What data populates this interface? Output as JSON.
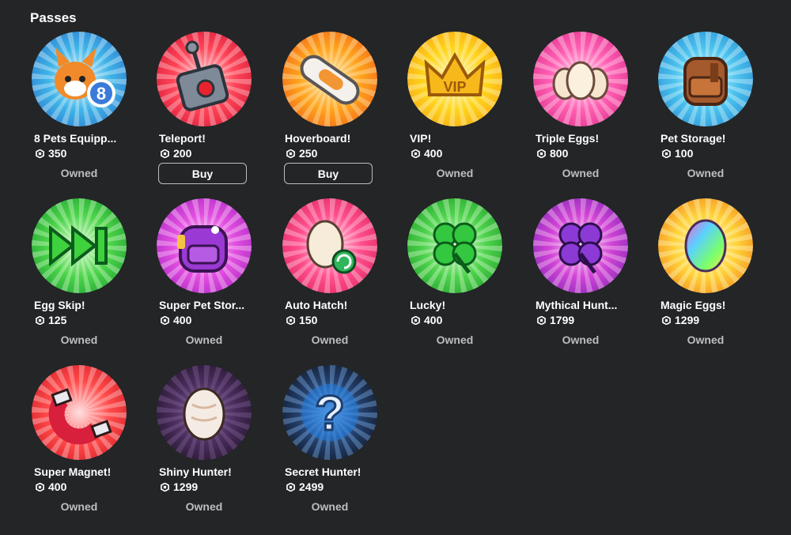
{
  "section_title": "Passes",
  "buy_label": "Buy",
  "owned_label": "Owned",
  "passes": [
    {
      "name": "8 Pets Equipp...",
      "price": "350",
      "status": "Owned",
      "icon": "dog-pet-icon",
      "colors": [
        "#e9fbff",
        "#3fb3e8",
        "#2f7fd0"
      ]
    },
    {
      "name": "Teleport!",
      "price": "200",
      "status": "Buy",
      "icon": "teleport-button-icon",
      "colors": [
        "#ffe0e3",
        "#ff4457",
        "#d81f3c"
      ]
    },
    {
      "name": "Hoverboard!",
      "price": "250",
      "status": "Buy",
      "icon": "hoverboard-icon",
      "colors": [
        "#fff4c7",
        "#ffa21c",
        "#f26a1a"
      ]
    },
    {
      "name": "VIP!",
      "price": "400",
      "status": "Owned",
      "icon": "vip-crown-icon",
      "colors": [
        "#fffbd0",
        "#ffd41c",
        "#f5a813"
      ]
    },
    {
      "name": "Triple Eggs!",
      "price": "800",
      "status": "Owned",
      "icon": "triple-eggs-icon",
      "colors": [
        "#ffe7f4",
        "#ff5fb3",
        "#e0338f"
      ]
    },
    {
      "name": "Pet Storage!",
      "price": "100",
      "status": "Owned",
      "icon": "backpack-icon",
      "colors": [
        "#e5fbff",
        "#4cc3ee",
        "#2c93d6"
      ]
    },
    {
      "name": "Egg Skip!",
      "price": "125",
      "status": "Owned",
      "icon": "skip-forward-icon",
      "colors": [
        "#e3ffd9",
        "#4dd44b",
        "#22a533"
      ]
    },
    {
      "name": "Super Pet Stor...",
      "price": "400",
      "status": "Owned",
      "icon": "purple-backpack-icon",
      "colors": [
        "#ffe2fb",
        "#e14ee0",
        "#b02cc4"
      ]
    },
    {
      "name": "Auto Hatch!",
      "price": "150",
      "status": "Owned",
      "icon": "auto-hatch-egg-icon",
      "colors": [
        "#ffe3ee",
        "#ff4f8d",
        "#e02a63"
      ]
    },
    {
      "name": "Lucky!",
      "price": "400",
      "status": "Owned",
      "icon": "clover-icon",
      "colors": [
        "#e6ffde",
        "#4fd34d",
        "#25a52e"
      ]
    },
    {
      "name": "Mythical Hunt...",
      "price": "1799",
      "status": "Owned",
      "icon": "purple-clover-icon",
      "colors": [
        "#ffd9f6",
        "#d044d6",
        "#8a2ab8"
      ]
    },
    {
      "name": "Magic Eggs!",
      "price": "1299",
      "status": "Owned",
      "icon": "rainbow-egg-icon",
      "colors": [
        "#fffbd0",
        "#ffd23a",
        "#f38d1c"
      ]
    },
    {
      "name": "Super Magnet!",
      "price": "400",
      "status": "Owned",
      "icon": "magnet-icon",
      "colors": [
        "#ffe0e0",
        "#ff4a4a",
        "#d8222b"
      ]
    },
    {
      "name": "Shiny Hunter!",
      "price": "1299",
      "status": "Owned",
      "icon": "shiny-egg-icon",
      "colors": [
        "#8a6aa0",
        "#4a2d5c",
        "#25162f"
      ]
    },
    {
      "name": "Secret Hunter!",
      "price": "2499",
      "status": "Owned",
      "icon": "secret-question-icon",
      "colors": [
        "#8fc4ff",
        "#23406d",
        "#121a2a"
      ]
    }
  ]
}
